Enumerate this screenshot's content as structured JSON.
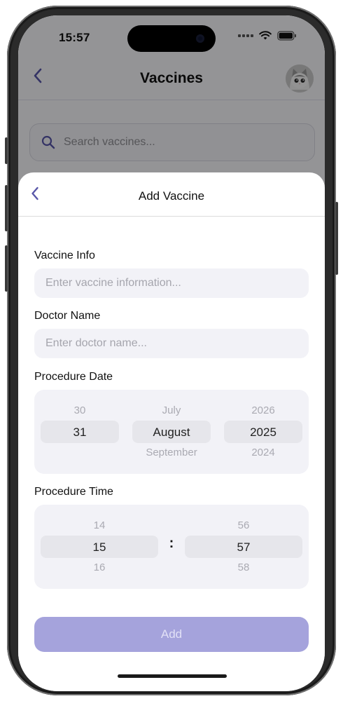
{
  "status_bar": {
    "time": "15:57"
  },
  "background_screen": {
    "title": "Vaccines",
    "search_placeholder": "Search vaccines..."
  },
  "sheet": {
    "title": "Add Vaccine",
    "fields": {
      "vaccine_info": {
        "label": "Vaccine Info",
        "placeholder": "Enter vaccine information...",
        "value": ""
      },
      "doctor_name": {
        "label": "Doctor Name",
        "placeholder": "Enter doctor name...",
        "value": ""
      }
    },
    "procedure_date": {
      "label": "Procedure Date",
      "day": {
        "prev": "30",
        "selected": "31",
        "next": ""
      },
      "month": {
        "prev": "July",
        "selected": "August",
        "next": "September"
      },
      "year": {
        "prev": "2026",
        "selected": "2025",
        "next": "2024"
      }
    },
    "procedure_time": {
      "label": "Procedure Time",
      "separator": ":",
      "hour": {
        "prev": "14",
        "selected": "15",
        "next": "16"
      },
      "minute": {
        "prev": "56",
        "selected": "57",
        "next": "58"
      }
    },
    "add_button": {
      "label": "Add",
      "enabled": false
    }
  },
  "colors": {
    "accent": "#5856a8",
    "add_button_disabled": "#a5a3dc",
    "field_background": "#f2f2f7",
    "picker_highlight": "#e6e6eb"
  },
  "icons": {
    "back": "chevron-left-icon",
    "search": "search-icon",
    "wifi": "wifi-icon",
    "battery": "battery-icon",
    "cellular": "cellular-signal-icon"
  }
}
